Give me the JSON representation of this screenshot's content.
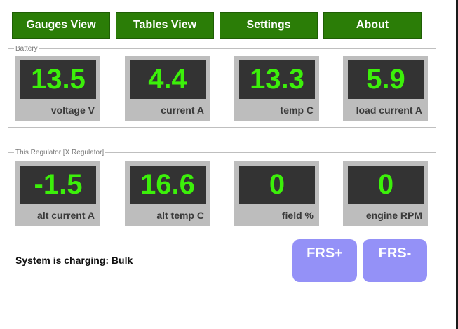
{
  "nav": {
    "gauges": "Gauges View",
    "tables": "Tables View",
    "settings": "Settings",
    "about": "About"
  },
  "battery": {
    "legend": "Battery",
    "tiles": [
      {
        "value": "13.5",
        "label": "voltage V"
      },
      {
        "value": "4.4",
        "label": "current A"
      },
      {
        "value": "13.3",
        "label": "temp C"
      },
      {
        "value": "5.9",
        "label": "load current A"
      }
    ]
  },
  "regulator": {
    "legend": "This Regulator [X Regulator]",
    "tiles": [
      {
        "value": "-1.5",
        "label": "alt current A"
      },
      {
        "value": "16.6",
        "label": "alt temp C"
      },
      {
        "value": "0",
        "label": "field %"
      },
      {
        "value": "0",
        "label": "engine RPM"
      }
    ],
    "status": "System is charging: Bulk",
    "frs_plus": "FRS+",
    "frs_minus": "FRS-"
  },
  "colors": {
    "nav_bg": "#2b7d07",
    "value_green": "#3cf00a",
    "screen_bg": "#333333",
    "tile_bg": "#bdbdbd",
    "frs_bg": "#9491f7"
  }
}
